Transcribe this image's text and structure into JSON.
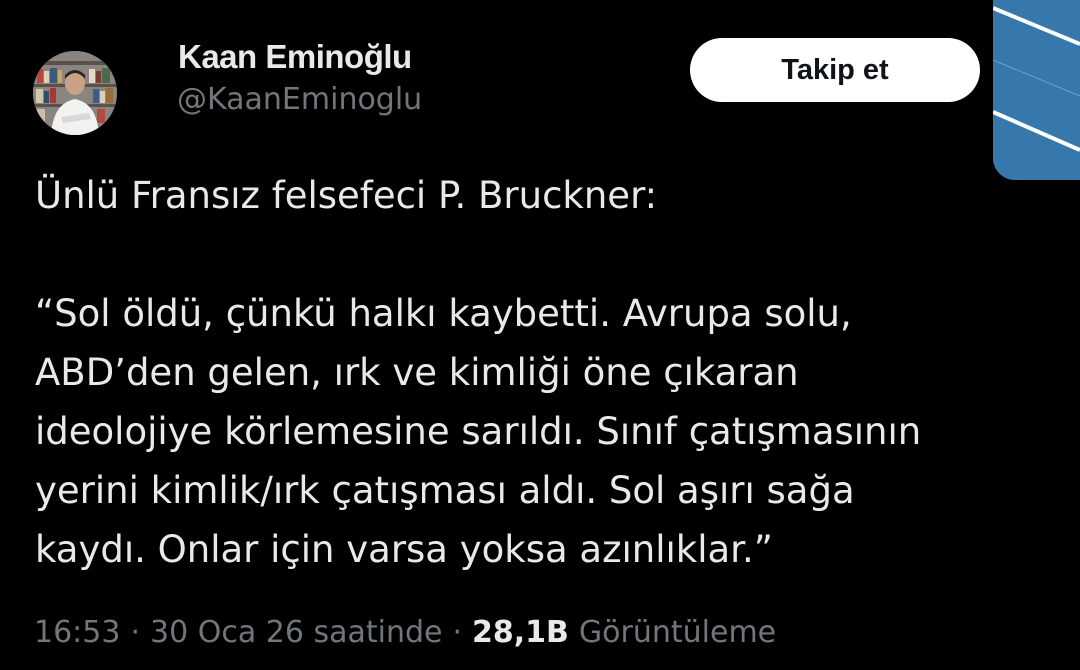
{
  "author": {
    "name": "Kaan Eminoğlu",
    "handle": "@KaanEminoglu"
  },
  "follow_button": {
    "label": "Takip et"
  },
  "tweet": {
    "lines": [
      "Ünlü Fransız felsefeci P. Bruckner:",
      "“Sol öldü, çünkü halkı kaybetti. Avrupa solu,",
      "ABD’den gelen, ırk ve kimliği öne çıkaran",
      "ideolojiye körlemesine sarıldı. Sınıf çatışmasının",
      "yerini kimlik/ırk çatışması aldı. Sol aşırı sağa",
      "kaydı. Onlar için varsa yoksa azınlıklar.”"
    ]
  },
  "meta": {
    "time": "16:53",
    "separator": "·",
    "date": "30 Oca 26 saatinde",
    "views_count": "28,1B",
    "views_label": "Görüntüleme"
  },
  "colors": {
    "background": "#000000",
    "primary_text": "#e7e9ea",
    "secondary_text": "#71767b",
    "button_bg": "#ffffff",
    "button_text": "#0f1419"
  }
}
